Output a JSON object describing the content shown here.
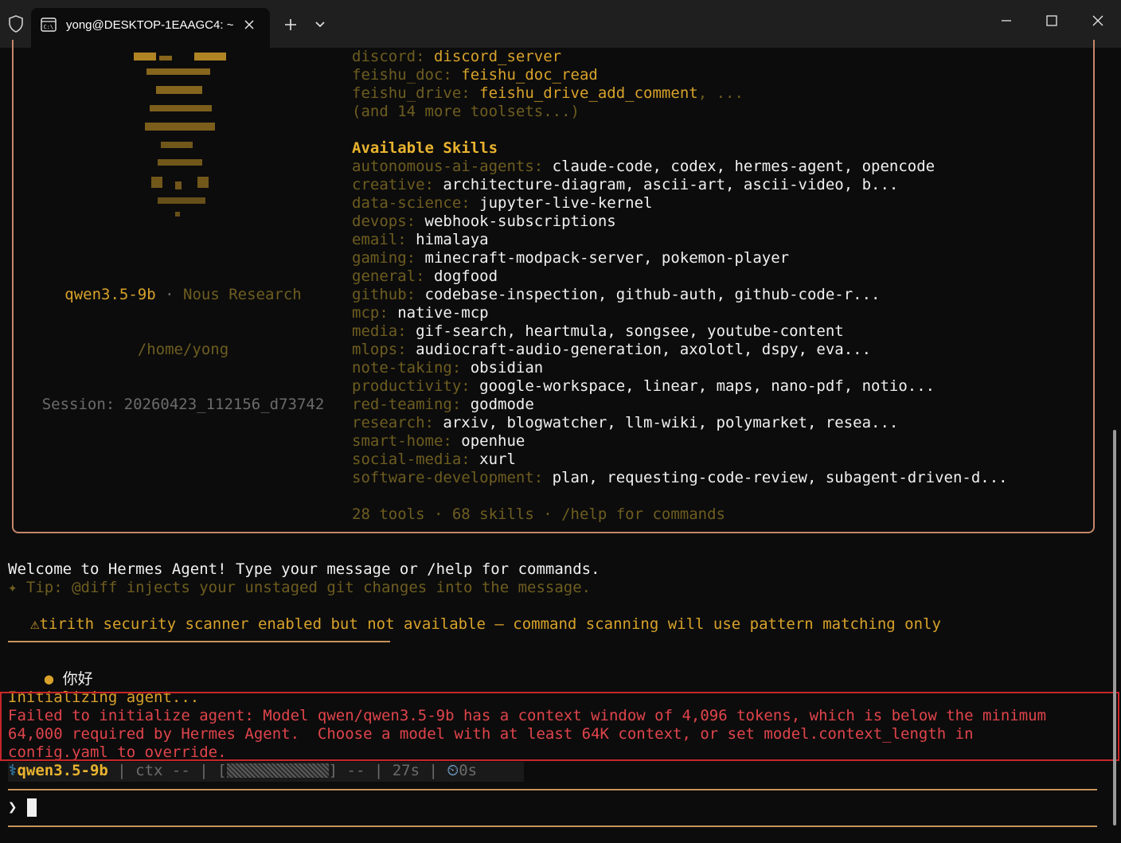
{
  "window": {
    "tab_title": "yong@DESKTOP-1EAAGC4: ~",
    "icons": [
      "shield-icon",
      "terminal-icon",
      "close-icon",
      "plus-icon",
      "chevron-down-icon",
      "minimize-icon",
      "maximize-icon",
      "window-close-icon"
    ]
  },
  "toolsets": [
    {
      "label": "discord: ",
      "value": "discord_server"
    },
    {
      "label": "feishu_doc: ",
      "value": "feishu_doc_read"
    },
    {
      "label": "feishu_drive: ",
      "value": "feishu_drive_add_comment",
      "suffix": ", ..."
    }
  ],
  "toolsets_more": "(and 14 more toolsets...)",
  "skills_heading": "Available Skills",
  "skills": [
    {
      "label": "autonomous-ai-agents: ",
      "value": "claude-code, codex, hermes-agent, opencode"
    },
    {
      "label": "creative: ",
      "value": "architecture-diagram, ascii-art, ascii-video, b..."
    },
    {
      "label": "data-science: ",
      "value": "jupyter-live-kernel"
    },
    {
      "label": "devops: ",
      "value": "webhook-subscriptions"
    },
    {
      "label": "email: ",
      "value": "himalaya"
    },
    {
      "label": "gaming: ",
      "value": "minecraft-modpack-server, pokemon-player"
    },
    {
      "label": "general: ",
      "value": "dogfood"
    },
    {
      "label": "github: ",
      "value": "codebase-inspection, github-auth, github-code-r..."
    },
    {
      "label": "mcp: ",
      "value": "native-mcp"
    },
    {
      "label": "media: ",
      "value": "gif-search, heartmula, songsee, youtube-content"
    },
    {
      "label": "mlops: ",
      "value": "audiocraft-audio-generation, axolotl, dspy, eva..."
    },
    {
      "label": "note-taking: ",
      "value": "obsidian"
    },
    {
      "label": "productivity: ",
      "value": "google-workspace, linear, maps, nano-pdf, notio..."
    },
    {
      "label": "red-teaming: ",
      "value": "godmode"
    },
    {
      "label": "research: ",
      "value": "arxiv, blogwatcher, llm-wiki, polymarket, resea..."
    },
    {
      "label": "smart-home: ",
      "value": "openhue"
    },
    {
      "label": "social-media: ",
      "value": "xurl"
    },
    {
      "label": "software-development: ",
      "value": "plan, requesting-code-review, subagent-driven-d..."
    }
  ],
  "summary": "28 tools · 68 skills · /help for commands",
  "model": {
    "name": "qwen3.5-9b",
    "separator": " · ",
    "org": "Nous Research",
    "path": "/home/yong",
    "session": "Session: 20260423_112156_d73742"
  },
  "welcome": "Welcome to Hermes Agent! Type your message or /help for commands.",
  "tip": "✦ Tip: @diff injects your unstaged git changes into the message.",
  "warning": "⚠tirith security scanner enabled but not available — command scanning will use pattern matching only",
  "user_bullet": "●",
  "user_message": "你好",
  "init_line": "Initializing agent...",
  "error_lines": [
    "Failed to initialize agent: Model qwen/qwen3.5-9b has a context window of 4,096 tokens, which is below the minimum",
    "64,000 required by Hermes Agent.  Choose a model with at least 64K context, or set model.context_length in",
    "config.yaml to override."
  ],
  "status": {
    "model_icon": "⚕",
    "model": "qwen3.5-9b",
    "sep": " | ",
    "ctx": "ctx --",
    "bar_open": "[",
    "bar_close": "]",
    "bar_value": "--",
    "elapsed": "27s",
    "timer_icon": "⏲",
    "timer": "0s"
  },
  "prompt": "❯",
  "colors": {
    "accent": "#d8a22a",
    "label": "#6e5d20",
    "error": "#e0444b",
    "border": "#c5876a"
  }
}
